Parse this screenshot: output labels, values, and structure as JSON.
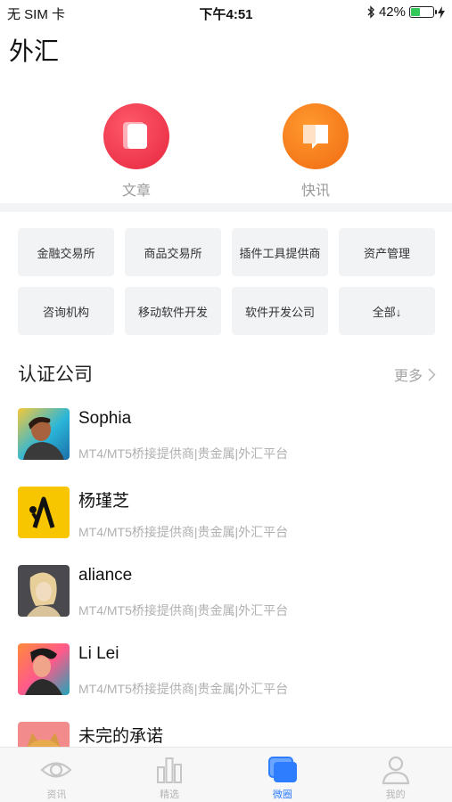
{
  "status_bar": {
    "carrier": "无 SIM 卡",
    "time": "下午4:51",
    "battery": "42%",
    "battery_level": 0.42
  },
  "page_title": "外汇",
  "quick_entries": [
    {
      "label": "文章",
      "icon": "document-icon",
      "color": "#e6263e"
    },
    {
      "label": "快讯",
      "icon": "chat-bubble-icon",
      "color": "#f06a12"
    }
  ],
  "categories": [
    "金融交易所",
    "商品交易所",
    "插件工具提供商",
    "资产管理",
    "咨询机构",
    "移动软件开发",
    "软件开发公司",
    "全部↓"
  ],
  "section": {
    "title": "认证公司",
    "more": "更多"
  },
  "companies": [
    {
      "name": "Sophia",
      "desc": "MT4/MT5桥接提供商|贵金属|外汇平台"
    },
    {
      "name": "杨瑾芝",
      "desc": "MT4/MT5桥接提供商|贵金属|外汇平台"
    },
    {
      "name": "aliance",
      "desc": "MT4/MT5桥接提供商|贵金属|外汇平台"
    },
    {
      "name": "Li Lei",
      "desc": "MT4/MT5桥接提供商|贵金属|外汇平台"
    },
    {
      "name": "未完的承诺",
      "desc": ""
    }
  ],
  "tabs": [
    {
      "label": "资讯",
      "icon": "eye-icon"
    },
    {
      "label": "精选",
      "icon": "bar-chart-icon"
    },
    {
      "label": "微圈",
      "icon": "chat-window-icon",
      "active": true
    },
    {
      "label": "我的",
      "icon": "user-icon"
    }
  ],
  "colors": {
    "accent": "#2f7dff",
    "muted_text": "#b0b0b0",
    "chip_bg": "#f2f3f5"
  }
}
